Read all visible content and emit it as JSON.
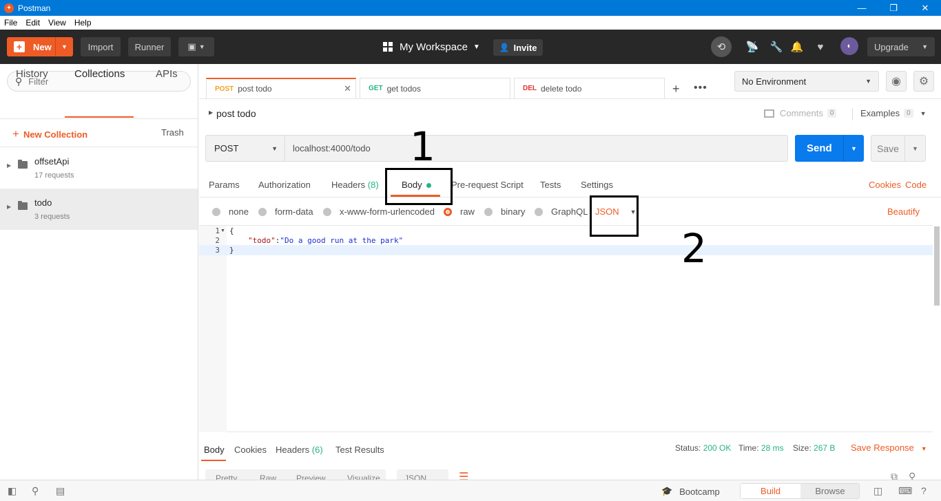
{
  "window": {
    "title": "Postman",
    "controls": {
      "minimize": "—",
      "restore": "❐",
      "close": "✕"
    }
  },
  "menu": [
    "File",
    "Edit",
    "View",
    "Help"
  ],
  "header": {
    "new_label": "New",
    "import_label": "Import",
    "runner_label": "Runner",
    "workspace_label": "My Workspace",
    "invite_label": "Invite",
    "upgrade_label": "Upgrade"
  },
  "sidebar": {
    "filter_placeholder": "Filter",
    "tabs": [
      "History",
      "Collections",
      "APIs"
    ],
    "active_tab": "Collections",
    "new_collection_label": "New Collection",
    "trash_label": "Trash",
    "collections": [
      {
        "name": "offsetApi",
        "count": "17 requests"
      },
      {
        "name": "todo",
        "count": "3 requests"
      }
    ]
  },
  "request_tabs": [
    {
      "method": "POST",
      "name": "post todo",
      "method_color": "#f4a022"
    },
    {
      "method": "GET",
      "name": "get todos",
      "method_color": "#26b47f"
    },
    {
      "method": "DEL",
      "name": "delete todo",
      "method_color": "#e2322f"
    }
  ],
  "environment": {
    "selected": "No Environment"
  },
  "request": {
    "name": "post todo",
    "comments_label": "Comments",
    "comments_count": "0",
    "examples_label": "Examples",
    "examples_count": "0",
    "method": "POST",
    "url": "localhost:4000/todo",
    "send_label": "Send",
    "save_label": "Save"
  },
  "section_tabs": {
    "params": "Params",
    "authorization": "Authorization",
    "headers": "Headers",
    "headers_count": "(8)",
    "body": "Body",
    "prerequest": "Pre-request Script",
    "tests": "Tests",
    "settings": "Settings",
    "cookies": "Cookies",
    "code": "Code"
  },
  "body_modes": {
    "none": "none",
    "form_data": "form-data",
    "urlencoded": "x-www-form-urlencoded",
    "raw": "raw",
    "binary": "binary",
    "graphql": "GraphQL",
    "selected": "raw",
    "format": "JSON",
    "beautify": "Beautify"
  },
  "editor": {
    "line_numbers": [
      "1",
      "2",
      "3"
    ],
    "line1": "{",
    "line2_key": "\"todo\"",
    "line2_sep": ":",
    "line2_value": "\"Do a good run at the park\"",
    "line3": "}"
  },
  "response": {
    "tabs": {
      "body": "Body",
      "cookies": "Cookies",
      "headers": "Headers",
      "headers_count": "(6)",
      "test_results": "Test Results"
    },
    "status_label": "Status:",
    "status_value": "200 OK",
    "time_label": "Time:",
    "time_value": "28 ms",
    "size_label": "Size:",
    "size_value": "267 B",
    "save_response": "Save Response",
    "sub_tabs": [
      "Pretty",
      "Raw",
      "Preview",
      "Visualize"
    ],
    "format": "JSON"
  },
  "footer": {
    "bootcamp": "Bootcamp",
    "build": "Build",
    "browse": "Browse"
  },
  "annotations": {
    "first": "1",
    "second": "2"
  }
}
